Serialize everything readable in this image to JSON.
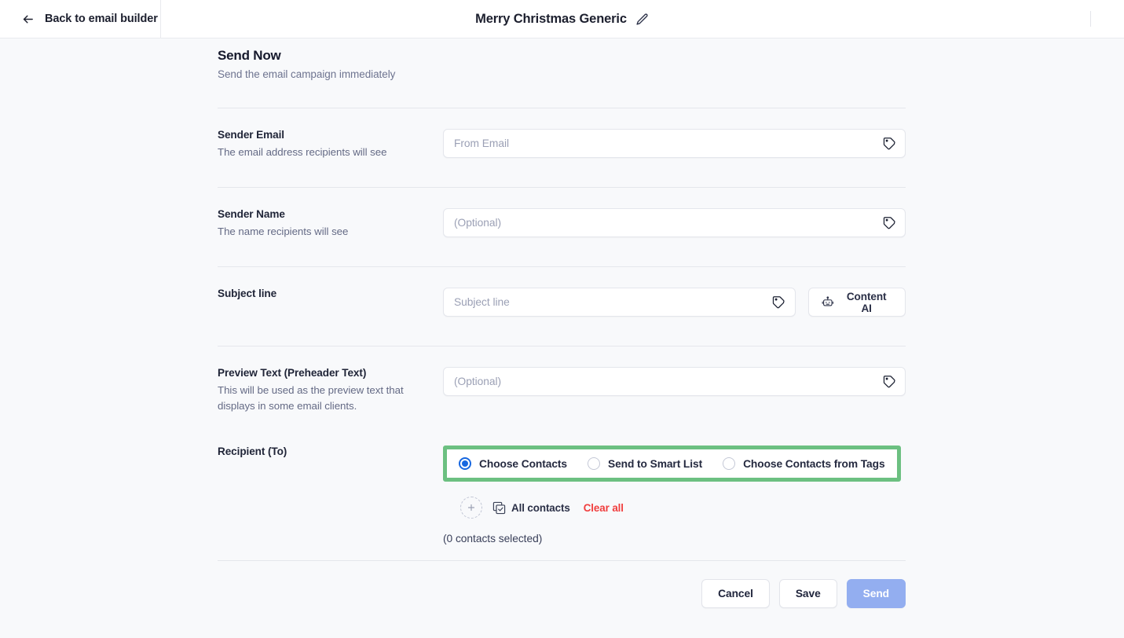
{
  "topbar": {
    "back_label": "Back to email builder",
    "back_icon": "arrow-left-icon",
    "title": "Merry Christmas Generic",
    "edit_icon": "pencil-icon"
  },
  "section": {
    "title": "Send Now",
    "subtitle": "Send the email campaign immediately"
  },
  "fields": {
    "sender_email": {
      "label": "Sender Email",
      "description": "The email address recipients will see",
      "placeholder": "From Email",
      "value": "",
      "icon": "tag-icon"
    },
    "sender_name": {
      "label": "Sender Name",
      "description": "The name recipients will see",
      "placeholder": "(Optional)",
      "value": "",
      "icon": "tag-icon"
    },
    "subject_line": {
      "label": "Subject line",
      "description": "",
      "placeholder": "Subject line",
      "value": "",
      "icon": "tag-icon",
      "content_ai_label": "Content AI",
      "content_ai_icon": "robot-icon"
    },
    "preview_text": {
      "label": "Preview Text (Preheader Text)",
      "description": "This will be used as the preview text that displays in some email clients.",
      "placeholder": "(Optional)",
      "value": "",
      "icon": "tag-icon"
    }
  },
  "recipient": {
    "label": "Recipient (To)",
    "options": [
      {
        "label": "Choose Contacts",
        "selected": true
      },
      {
        "label": "Send to Smart List",
        "selected": false
      },
      {
        "label": "Choose Contacts from Tags",
        "selected": false
      }
    ],
    "add_icon": "plus-icon",
    "all_contacts_label": "All contacts",
    "all_contacts_icon": "multi-select-check-icon",
    "clear_all_label": "Clear all",
    "selected_count_text": "(0 contacts selected)",
    "highlight_color": "#6cc081"
  },
  "footer": {
    "cancel_label": "Cancel",
    "save_label": "Save",
    "send_label": "Send",
    "send_color": "#93aef0"
  }
}
